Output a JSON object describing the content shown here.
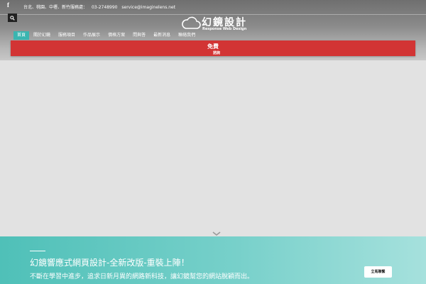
{
  "topbar": {
    "facebook_icon": "f",
    "service_area": "台北、桃園、中壢、新竹服務處：",
    "phone": "03-2748990",
    "email": "service@imaginelens.net"
  },
  "search": {
    "icon": "search-icon"
  },
  "logo": {
    "title": "幻鏡設計",
    "subtitle": "Response Web Design"
  },
  "nav": {
    "items": [
      {
        "label": "首頁",
        "active": true
      },
      {
        "label": "關於幻鏡",
        "active": false
      },
      {
        "label": "服務項目",
        "active": false
      },
      {
        "label": "作品展示",
        "active": false
      },
      {
        "label": "價格方案",
        "active": false
      },
      {
        "label": "問與答",
        "active": false
      },
      {
        "label": "最新消息",
        "active": false
      },
      {
        "label": "聯絡我們",
        "active": false
      }
    ],
    "active_color": "#3ab5b0"
  },
  "banner": {
    "title": "免費",
    "subtitle": "諮詢",
    "color": "#d23434"
  },
  "promo": {
    "title": "幻鏡響應式網頁設計-全新改版-重裝上陣！",
    "description": "不斷在學習中進步，追求日新月異的網路新科技，讓幻鏡幫您的網站脫穎而出。",
    "cta_label": "立馬聯繫",
    "color_start": "#4fc0b8",
    "color_end": "#a6e1dd"
  }
}
